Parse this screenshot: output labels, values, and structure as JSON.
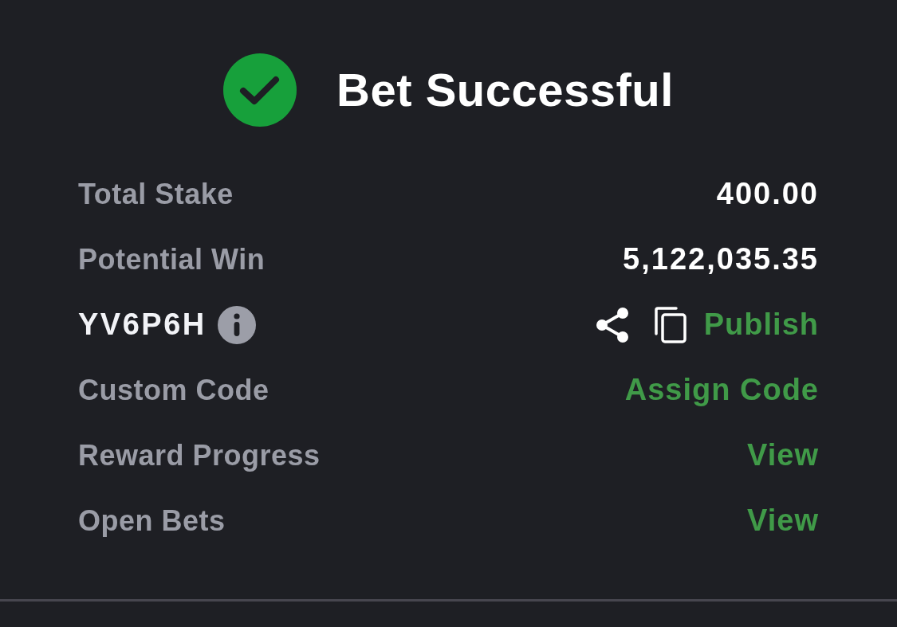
{
  "header": {
    "title": "Bet Successful"
  },
  "rows": [
    {
      "kind": "value",
      "label": "Total Stake",
      "value": "400.00"
    },
    {
      "kind": "value",
      "label": "Potential Win",
      "value": "5,122,035.35"
    },
    {
      "kind": "code",
      "code": "YV6P6H",
      "action": "Publish"
    },
    {
      "kind": "link",
      "label": "Custom Code",
      "action": "Assign Code"
    },
    {
      "kind": "link",
      "label": "Reward Progress",
      "action": "View"
    },
    {
      "kind": "link",
      "label": "Open Bets",
      "action": "View"
    }
  ]
}
